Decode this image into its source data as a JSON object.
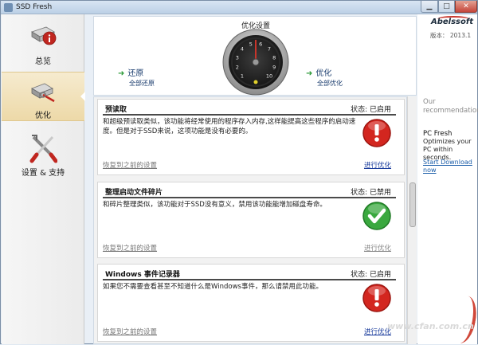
{
  "window": {
    "title": "SSD Fresh"
  },
  "sidebar": {
    "items": [
      {
        "label": "总览",
        "icon": "hard-drive-info-icon"
      },
      {
        "label": "优化",
        "icon": "ssd-tune-icon"
      },
      {
        "label": "设置 & 支持",
        "icon": "tools-icon"
      }
    ]
  },
  "header": {
    "title": "优化设置",
    "restore": {
      "label": "还原",
      "sub": "全部还原"
    },
    "optimize": {
      "label": "优化",
      "sub": "全部优化"
    },
    "gauge_numbers": [
      "1",
      "2",
      "3",
      "4",
      "5",
      "6",
      "7",
      "8",
      "9",
      "10"
    ]
  },
  "cards": [
    {
      "title": "预读取",
      "status": "状态: 已启用",
      "description": "和超级预读取类似，该功能将经常使用的程序存入内存,这样能提高这些程序的启动速度。但是对于SSD来说，这项功能是没有必要的。",
      "restore": "恢复到之前的设置",
      "optimize": "进行优化",
      "state": "bad"
    },
    {
      "title": "整理启动文件碎片",
      "status": "状态: 已禁用",
      "description": "和碎片整理类似，该功能对于SSD没有意义，禁用该功能能增加磁盘寿命。",
      "restore": "恢复到之前的设置",
      "optimize": "进行优化",
      "state": "good"
    },
    {
      "title": "Windows 事件记录器",
      "status": "状态: 已启用",
      "description": "如果您不需要查看甚至不知道什么是Windows事件，那么请禁用此功能。",
      "restore": "恢复到之前的设置",
      "optimize": "进行优化",
      "state": "bad"
    }
  ],
  "right": {
    "brand": "Abelssoft",
    "version": "版本： 2013.1",
    "rec_title": "Our recommendations:",
    "product": "PC Fresh",
    "product_desc": "Optimizes your PC within seconds.",
    "download": "Start Download now"
  },
  "watermark": "www.cfan.com.cn",
  "colors": {
    "bad": "#d3261f",
    "good": "#3aa83f",
    "accent_link": "#1a3c9c",
    "selected_nav": "#edd9a8"
  }
}
